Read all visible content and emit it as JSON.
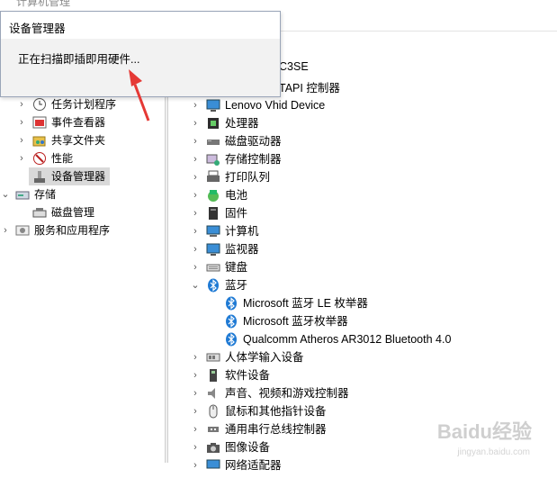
{
  "window": {
    "partial_title": "计算机管理"
  },
  "popup": {
    "title": "设备管理器",
    "message": "正在扫描即插即用硬件..."
  },
  "left_tree": [
    {
      "label": "任务计划程序",
      "icon": "clock-icon"
    },
    {
      "label": "事件查看器",
      "icon": "event-viewer-icon"
    },
    {
      "label": "共享文件夹",
      "icon": "shared-folder-icon"
    },
    {
      "label": "性能",
      "icon": "performance-icon"
    },
    {
      "label": "设备管理器",
      "icon": "device-manager-icon",
      "selected": true
    },
    {
      "label": "存储",
      "icon": "storage-icon",
      "expanded": true
    },
    {
      "label": "磁盘管理",
      "icon": "disk-management-icon"
    },
    {
      "label": "服务和应用程序",
      "icon": "services-icon"
    }
  ],
  "right_tree": {
    "partial_top": [
      "C3SE",
      "TAPI 控制器"
    ],
    "items": [
      {
        "label": "Lenovo Vhid Device",
        "icon": "monitor-icon"
      },
      {
        "label": "处理器",
        "icon": "cpu-icon"
      },
      {
        "label": "磁盘驱动器",
        "icon": "disk-drive-icon"
      },
      {
        "label": "存储控制器",
        "icon": "storage-controller-icon"
      },
      {
        "label": "打印队列",
        "icon": "printer-icon"
      },
      {
        "label": "电池",
        "icon": "battery-icon"
      },
      {
        "label": "固件",
        "icon": "firmware-icon"
      },
      {
        "label": "计算机",
        "icon": "computer-icon"
      },
      {
        "label": "监视器",
        "icon": "monitor-icon"
      },
      {
        "label": "键盘",
        "icon": "keyboard-icon"
      },
      {
        "label": "蓝牙",
        "icon": "bluetooth-icon",
        "expanded": true
      },
      {
        "label": "Microsoft 蓝牙 LE 枚举器",
        "icon": "bluetooth-icon",
        "child": true
      },
      {
        "label": "Microsoft 蓝牙枚举器",
        "icon": "bluetooth-icon",
        "child": true
      },
      {
        "label": "Qualcomm Atheros AR3012 Bluetooth 4.0",
        "icon": "bluetooth-icon",
        "child": true
      },
      {
        "label": "人体学输入设备",
        "icon": "hid-icon"
      },
      {
        "label": "软件设备",
        "icon": "software-device-icon"
      },
      {
        "label": "声音、视频和游戏控制器",
        "icon": "speaker-icon"
      },
      {
        "label": "鼠标和其他指针设备",
        "icon": "mouse-icon"
      },
      {
        "label": "通用串行总线控制器",
        "icon": "usb-icon"
      },
      {
        "label": "图像设备",
        "icon": "camera-icon"
      },
      {
        "label": "网络适配器",
        "icon": "network-icon"
      }
    ]
  },
  "watermark": {
    "brand": "Baidu经验",
    "url": "jingyan.baidu.com"
  },
  "colors": {
    "arrow": "#e53935",
    "bluetooth": "#1f7ad4",
    "selection": "#d9d9d9"
  }
}
